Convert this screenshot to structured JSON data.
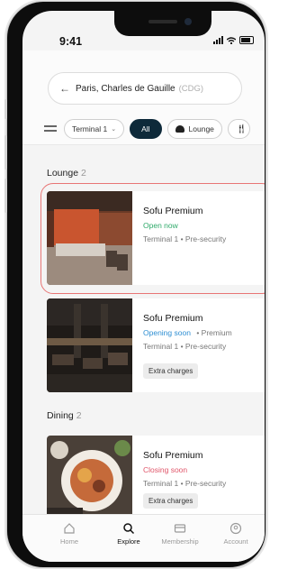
{
  "status_bar": {
    "time": "9:41"
  },
  "search": {
    "location": "Paris, Charles de Gauille",
    "code": "(CDG)"
  },
  "filters": {
    "terminal": "Terminal 1",
    "all": "All",
    "lounge": "Lounge"
  },
  "sections": [
    {
      "title": "Lounge",
      "count": "2"
    },
    {
      "title": "Dining",
      "count": "2"
    }
  ],
  "cards": [
    {
      "name": "Sofu Premium",
      "status": "Open now",
      "status_color": "#2faa6a",
      "meta": "Terminal 1 • Pre-security",
      "tag": ""
    },
    {
      "name": "Sofu Premium",
      "status": "Opening soon",
      "status_color": "#2f8fd3",
      "status_extra": "• Premium",
      "meta": "Terminal 1 • Pre-security",
      "tag": "Extra charges"
    },
    {
      "name": "Sofu Premium",
      "status": "Closing soon",
      "status_color": "#e0566a",
      "meta": "Terminal 1 • Pre-security",
      "tag": "Extra charges"
    }
  ],
  "tabs": [
    {
      "label": "Home",
      "icon": "home-icon"
    },
    {
      "label": "Explore",
      "icon": "search-icon"
    },
    {
      "label": "Membership",
      "icon": "card-icon"
    },
    {
      "label": "Account",
      "icon": "account-icon"
    }
  ],
  "colors": {
    "accent": "#0e2a3a",
    "highlight": "#e87575"
  }
}
